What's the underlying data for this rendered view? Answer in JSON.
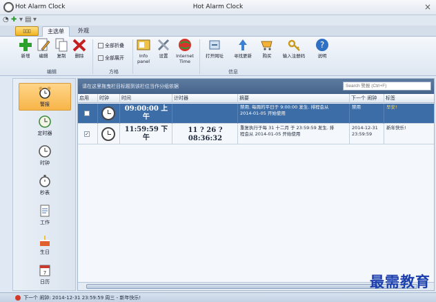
{
  "titlebar": {
    "app_name": "Hot Alarm Clock",
    "window_title": "Hot Alarm Clock",
    "close_glyph": "×"
  },
  "tabs": {
    "file": "▯▯▯",
    "home": "主选单",
    "appearance": "外观"
  },
  "ribbon": {
    "edit_group": {
      "label": "编辑",
      "new": "新增",
      "edit": "编辑",
      "copy": "复制",
      "delete": "删除"
    },
    "method_group": {
      "label": "方格",
      "collapse_all": "全部折叠",
      "expand_all": "全部展开"
    },
    "info_group": {
      "label": "信息",
      "info_panel": "Info\npanel",
      "settings": "设置",
      "internet_time": "Internet\nTime",
      "open_site": "打开网址",
      "check_update": "寻找更新",
      "buy": "购买",
      "enter_code": "输入注册码",
      "help": "说明"
    }
  },
  "nav": {
    "items": [
      {
        "label": "警报",
        "icon": "alarm-clock-icon"
      },
      {
        "label": "定时器",
        "icon": "timer-icon"
      },
      {
        "label": "时钟",
        "icon": "clock-icon"
      },
      {
        "label": "秒表",
        "icon": "stopwatch-icon"
      },
      {
        "label": "工作",
        "icon": "task-icon"
      },
      {
        "label": "生日",
        "icon": "birthday-cake-icon"
      },
      {
        "label": "日历",
        "icon": "calendar-icon"
      }
    ]
  },
  "grid": {
    "group_hint": "请在这里拖曳栏目标题到该栏位当作分组依据",
    "search_placeholder": "Search 警报 (Ctrl+F)",
    "columns": [
      "启用",
      "时钟",
      "时间",
      "计时器",
      "摘要",
      "下一个 闹钟",
      "标签"
    ],
    "rows": [
      {
        "enabled": false,
        "time_line1": "09:00:00 上",
        "time_line2": "午",
        "timer_line1": "",
        "timer_line2": "",
        "summary_line1": "禁用. 每周的平日于 9:00:00 发生. 排程会从",
        "summary_line2": "2014-01-05 开始使用",
        "next_line1": "禁用",
        "next_line2": "",
        "label": "早安!"
      },
      {
        "enabled": true,
        "time_line1": "11:59:59 下",
        "time_line2": "午",
        "timer_line1": "11 ? 26 ?",
        "timer_line2": "08:36:32",
        "summary_line1": "重复执行于每 31 十二月 于 23:59:59 发生. 排",
        "summary_line2": "程会从 2014-01-05 开始使用",
        "next_line1": "2014-12-31",
        "next_line2": "23:59:59",
        "label": "新年快乐!"
      }
    ]
  },
  "statusbar": {
    "text": "下一个 闹钟: 2014-12-31 23:59:59 周三 - 新年快乐!"
  },
  "watermark": "最需教育",
  "colors": {
    "selected_row": "#3c6da6",
    "active_nav": "#f7b548",
    "group_bar": "#46648b",
    "watermark": "#1c3fae"
  }
}
